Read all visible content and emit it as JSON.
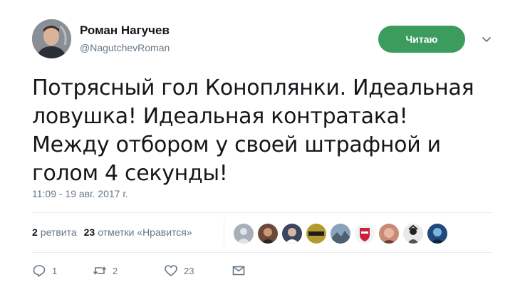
{
  "author": {
    "name": "Роман Нагучев",
    "handle": "@NagutchevRoman"
  },
  "follow_button": {
    "label": "Читаю"
  },
  "tweet": {
    "text": "Потрясный гол Коноплянки. Идеальная ловушка! Идеальная контратака! Между отбором у своей штрафной и голом 4 секунды!",
    "timestamp": "11:09 - 19 авг. 2017 г."
  },
  "stats": {
    "retweets_count": "2",
    "retweets_label": "ретвита",
    "likes_count": "23",
    "likes_label": "отметки «Нравится»"
  },
  "likers": [
    {
      "name": "liker-avatar-1",
      "color": "#a7b0b8"
    },
    {
      "name": "liker-avatar-2",
      "color": "#6b4a3a"
    },
    {
      "name": "liker-avatar-3",
      "color": "#3a4660"
    },
    {
      "name": "liker-avatar-4",
      "color": "#b59b2f"
    },
    {
      "name": "liker-avatar-5",
      "color": "#8aa2bd"
    },
    {
      "name": "liker-avatar-6",
      "color": "#c8233a"
    },
    {
      "name": "liker-avatar-7",
      "color": "#c98a76"
    },
    {
      "name": "liker-avatar-8",
      "color": "#e9e9e9"
    },
    {
      "name": "liker-avatar-9",
      "color": "#214a7a"
    }
  ],
  "actions": {
    "reply_count": "1",
    "retweet_count": "2",
    "like_count": "23"
  },
  "icons": {
    "reply": "reply-icon",
    "retweet": "retweet-icon",
    "like": "heart-icon",
    "dm": "envelope-icon",
    "caret": "chevron-down-icon"
  },
  "colors": {
    "follow_green": "#3b9c5e",
    "secondary_text": "#657786",
    "divider": "#e6ecf0"
  }
}
